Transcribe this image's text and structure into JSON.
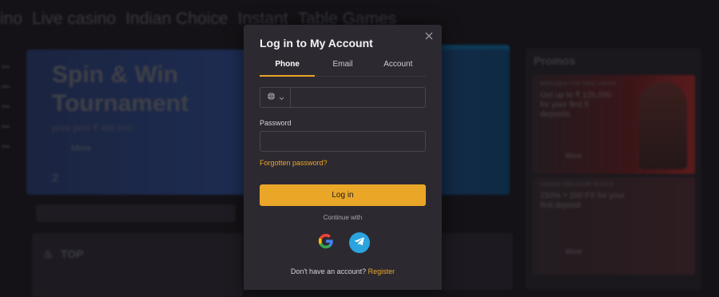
{
  "background": {
    "nav": [
      "ino",
      "Live casino",
      "Indian Choice",
      "Instant",
      "Table Games"
    ],
    "hero": {
      "title": "Spin & Win Tournament",
      "subtitle": "prize pool ₹ 450 000",
      "more": "More",
      "number": "2"
    },
    "top_section": "TOP",
    "promos": {
      "title": "Promos",
      "promo1": {
        "tag": "BONUSES FOR NEW USERS",
        "text": "Get up to ₹ 125,000 for your first 5 deposits",
        "more": "More"
      },
      "promo2": {
        "tag": "CASINO WELCOME BONUS",
        "text": "150% + 200 FS for your first deposit",
        "more": "More"
      }
    }
  },
  "modal": {
    "title": "Log in to My Account",
    "tabs": [
      {
        "label": "Phone",
        "active": true
      },
      {
        "label": "Email",
        "active": false
      },
      {
        "label": "Account",
        "active": false
      }
    ],
    "phone": {
      "value": "",
      "placeholder": ""
    },
    "password_label": "Password",
    "password": {
      "value": "",
      "placeholder": ""
    },
    "forgot_label": "Forgotten password?",
    "login_label": "Log in",
    "continue_label": "Continue with",
    "social": [
      {
        "icon": "google-icon"
      },
      {
        "icon": "telegram-icon"
      }
    ],
    "register_prompt": "Don't have an account?",
    "register_label": "Register"
  },
  "colors": {
    "accent": "#e9a627",
    "modal_bg": "#2d2931",
    "page_bg": "#141216",
    "telegram": "#2aa3de"
  }
}
